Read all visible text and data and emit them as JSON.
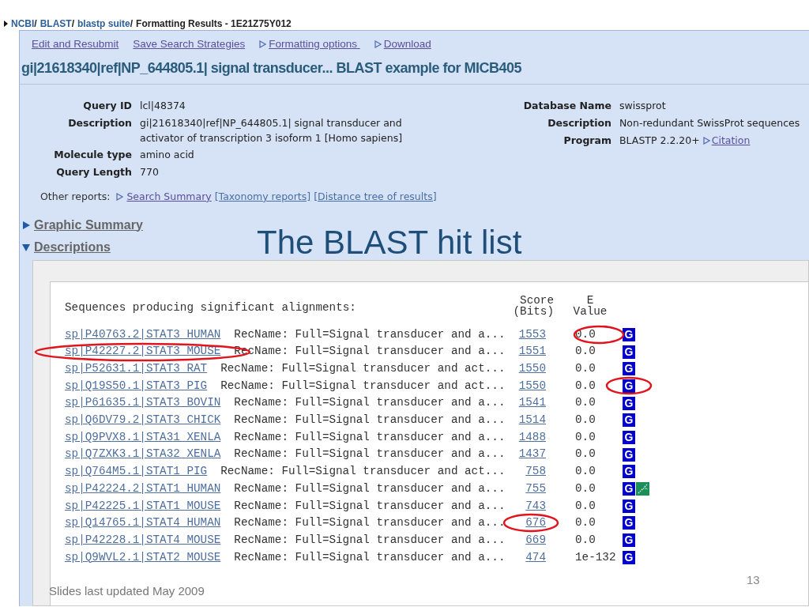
{
  "breadcrumb": {
    "items": [
      {
        "label": "NCBI",
        "sep": "/"
      },
      {
        "label": "BLAST",
        "sep": "/"
      },
      {
        "label": "blastp suite",
        "sep": "/"
      }
    ],
    "current": "Formatting Results - 1E21Z75Y012"
  },
  "toolbar": [
    {
      "label": "Edit and Resubmit",
      "has_arrow": false
    },
    {
      "label": "Save Search Strategies",
      "has_arrow": false
    },
    {
      "label": "Formatting options ",
      "has_arrow": true
    },
    {
      "label": "Download",
      "has_arrow": true
    }
  ],
  "title": "gi|21618340|ref|NP_644805.1| signal transducer... BLAST example for MICB405",
  "query_info": [
    {
      "label": "Query ID",
      "value": "lcl|48374"
    },
    {
      "label": "Description",
      "value": "gi|21618340|ref|NP_644805.1| signal transducer and activator of transcription 3 isoform 1 [Homo sapiens]"
    },
    {
      "label": "Molecule type",
      "value": "amino acid"
    },
    {
      "label": "Query Length",
      "value": "770"
    }
  ],
  "database_info": [
    {
      "label": "Database Name",
      "value": "swissprot"
    },
    {
      "label": "Description",
      "value": "Non-redundant SwissProt sequences"
    },
    {
      "label": "Program",
      "value": "BLASTP 2.2.20+",
      "link": "Citation"
    }
  ],
  "other_reports": {
    "label": "Other reports:",
    "links": [
      {
        "label": "Search Summary",
        "has_arrow": true
      },
      {
        "label": "[Taxonomy reports]",
        "has_arrow": false
      },
      {
        "label": "[Distance tree of results]",
        "has_arrow": false
      }
    ]
  },
  "sections": [
    {
      "label": "Graphic Summary",
      "expanded": false
    },
    {
      "label": "Descriptions",
      "expanded": true
    }
  ],
  "hit_list": {
    "heading": "Sequences producing significant alignments:",
    "score_header": [
      "Score",
      "(Bits)"
    ],
    "evalue_header": [
      "E",
      "Value"
    ],
    "rows": [
      {
        "id": "sp|P40763.2|STAT3_HUMAN",
        "description": "RecName: Full=Signal transducer and a...",
        "score": "1553",
        "evalue": "0.0",
        "gene_link": "G",
        "structure_link": false,
        "evalue_circled": true
      },
      {
        "id": "sp|P42227.2|STAT3_MOUSE",
        "description": "RecName: Full=Signal transducer and a...",
        "score": "1551",
        "evalue": "0.0",
        "gene_link": "G",
        "structure_link": false,
        "id_circled": true
      },
      {
        "id": "sp|P52631.1|STAT3_RAT",
        "description": "RecName: Full=Signal transducer and act...",
        "score": "1550",
        "evalue": "0.0",
        "gene_link": "G",
        "structure_link": false
      },
      {
        "id": "sp|Q19S50.1|STAT3_PIG",
        "description": "RecName: Full=Signal transducer and act...",
        "score": "1550",
        "evalue": "0.0",
        "gene_link": "G",
        "structure_link": false,
        "link_circled": true
      },
      {
        "id": "sp|P61635.1|STAT3_BOVIN",
        "description": "RecName: Full=Signal transducer and a...",
        "score": "1541",
        "evalue": "0.0",
        "gene_link": "G",
        "structure_link": false
      },
      {
        "id": "sp|Q6DV79.2|STAT3_CHICK",
        "description": "RecName: Full=Signal transducer and a...",
        "score": "1514",
        "evalue": "0.0",
        "gene_link": "G",
        "structure_link": false
      },
      {
        "id": "sp|Q9PVX8.1|STA31_XENLA",
        "description": "RecName: Full=Signal transducer and a...",
        "score": "1488",
        "evalue": "0.0",
        "gene_link": "G",
        "structure_link": false
      },
      {
        "id": "sp|Q7ZXK3.1|STA32_XENLA",
        "description": "RecName: Full=Signal transducer and a...",
        "score": "1437",
        "evalue": "0.0",
        "gene_link": "G",
        "structure_link": false
      },
      {
        "id": "sp|Q764M5.1|STAT1_PIG",
        "description": "RecName: Full=Signal transducer and act...",
        "score": "758",
        "evalue": "0.0",
        "gene_link": "G",
        "structure_link": false
      },
      {
        "id": "sp|P42224.2|STAT1_HUMAN",
        "description": "RecName: Full=Signal transducer and a...",
        "score": "755",
        "evalue": "0.0",
        "gene_link": "G",
        "structure_link": true
      },
      {
        "id": "sp|P42225.1|STAT1_MOUSE",
        "description": "RecName: Full=Signal transducer and a...",
        "score": "743",
        "evalue": "0.0",
        "gene_link": "G",
        "structure_link": false
      },
      {
        "id": "sp|Q14765.1|STAT4_HUMAN",
        "description": "RecName: Full=Signal transducer and a...",
        "score": "676",
        "evalue": "0.0",
        "gene_link": "G",
        "structure_link": false,
        "score_circled": true
      },
      {
        "id": "sp|P42228.1|STAT4_MOUSE",
        "description": "RecName: Full=Signal transducer and a...",
        "score": "669",
        "evalue": "0.0",
        "gene_link": "G",
        "structure_link": false
      },
      {
        "id": "sp|Q9WVL2.1|STAT2_MOUSE",
        "description": "RecName: Full=Signal transducer and a...",
        "score": "474",
        "evalue": "1e-132",
        "gene_link": "G",
        "structure_link": false
      }
    ]
  },
  "slide": {
    "title": "The BLAST hit list",
    "footer": "Slides last updated May 2009",
    "page_number": "13"
  }
}
